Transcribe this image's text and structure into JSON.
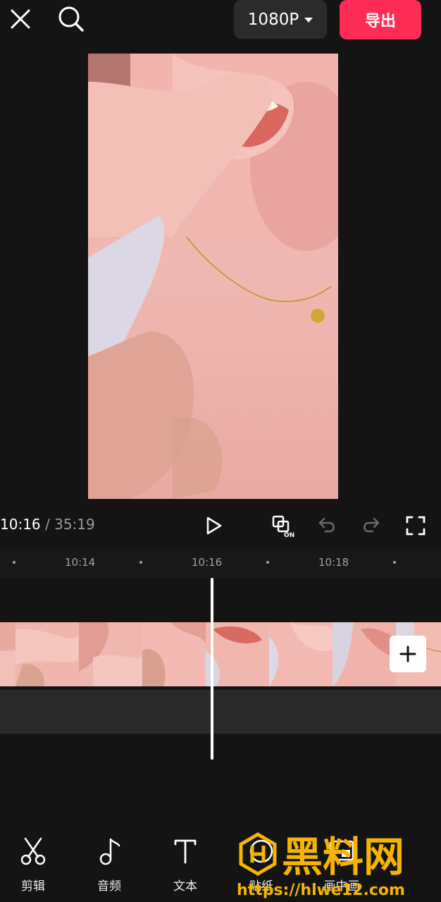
{
  "header": {
    "resolution_label": "1080P",
    "export_label": "导出",
    "icons": [
      "close-icon",
      "search-icon",
      "caret-down-icon"
    ]
  },
  "player": {
    "current_time": "10:16",
    "separator": "/",
    "total_time": "35:19",
    "icons": [
      "play-icon",
      "mirror-on-icon",
      "undo-icon",
      "redo-icon",
      "fullscreen-icon"
    ]
  },
  "ruler": {
    "ticks": [
      "10:14",
      "10:16",
      "10:18"
    ]
  },
  "timeline": {
    "add_label": "+"
  },
  "toolbar": {
    "items": [
      {
        "label": "剪辑",
        "icon": "scissors-icon"
      },
      {
        "label": "音频",
        "icon": "music-note-icon"
      },
      {
        "label": "文本",
        "icon": "text-icon"
      },
      {
        "label": "贴纸",
        "icon": "sticker-icon"
      },
      {
        "label": "画中画",
        "icon": "pip-icon"
      }
    ]
  },
  "watermark": {
    "text": "黑料网",
    "url": "https://hlwe12.com"
  },
  "colors": {
    "accent": "#fe2c55",
    "background": "#141414",
    "watermark_gold": "#f5b400"
  }
}
